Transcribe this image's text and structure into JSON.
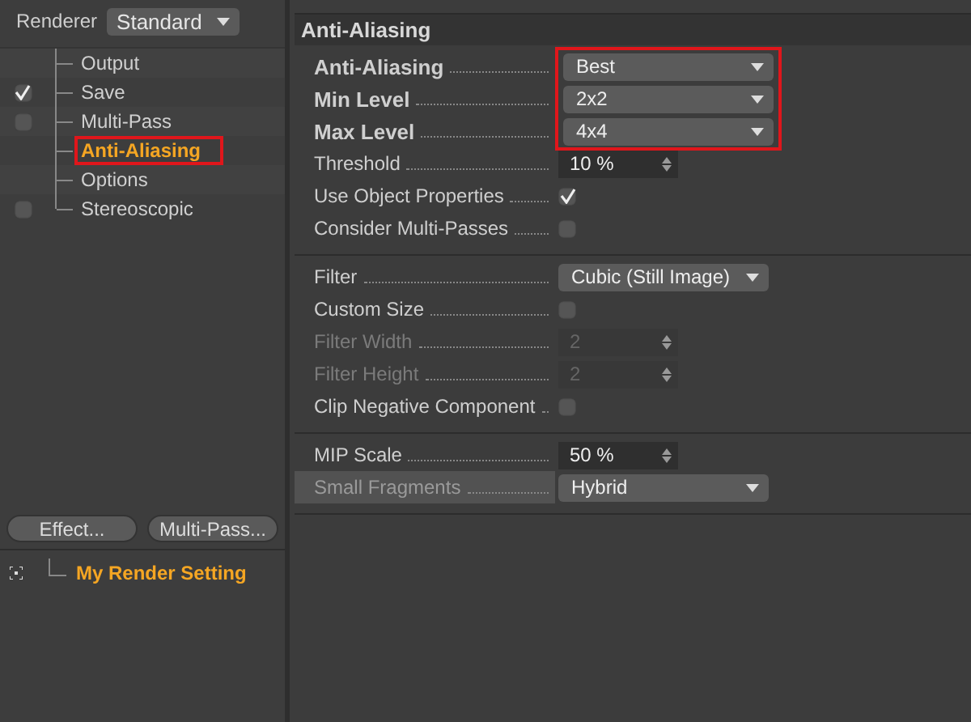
{
  "renderer": {
    "label": "Renderer",
    "value": "Standard"
  },
  "tree": [
    {
      "label": "Output",
      "has_checkbox": false,
      "selected": false,
      "marked": false
    },
    {
      "label": "Save",
      "has_checkbox": true,
      "checked": true,
      "selected": false,
      "marked": false
    },
    {
      "label": "Multi-Pass",
      "has_checkbox": true,
      "checked": false,
      "selected": false,
      "marked": false
    },
    {
      "label": "Anti-Aliasing",
      "has_checkbox": false,
      "selected": true,
      "marked": true
    },
    {
      "label": "Options",
      "has_checkbox": false,
      "selected": false,
      "marked": false
    },
    {
      "label": "Stereoscopic",
      "has_checkbox": true,
      "checked": false,
      "selected": false,
      "marked": false
    }
  ],
  "buttons": [
    "Effect...",
    "Multi-Pass..."
  ],
  "render_setting": {
    "label": "My Render Setting",
    "selected": true
  },
  "panel_title": "Anti-Aliasing",
  "sections": [
    {
      "groups": [
        {
          "marked": true,
          "rows": [
            {
              "kind": "dropdown",
              "label": "Anti-Aliasing",
              "value": "Best",
              "bold": true,
              "disabled": false,
              "highlighted": false
            },
            {
              "kind": "dropdown",
              "label": "Min Level",
              "value": "2x2",
              "bold": true,
              "disabled": false,
              "highlighted": false
            },
            {
              "kind": "dropdown",
              "label": "Max Level",
              "value": "4x4",
              "bold": true,
              "disabled": false,
              "highlighted": false
            }
          ]
        },
        {
          "marked": false,
          "rows": [
            {
              "kind": "spin",
              "label": "Threshold",
              "value": "10 %",
              "bold": false,
              "disabled": false,
              "highlighted": false
            },
            {
              "kind": "checkbox",
              "label": "Use Object Properties",
              "checked": true,
              "bold": false,
              "disabled": false,
              "highlighted": false
            },
            {
              "kind": "checkbox",
              "label": "Consider Multi-Passes",
              "checked": false,
              "bold": false,
              "disabled": false,
              "highlighted": false
            }
          ]
        }
      ]
    },
    {
      "groups": [
        {
          "marked": false,
          "rows": [
            {
              "kind": "dropdown",
              "label": "Filter",
              "value": "Cubic (Still Image)",
              "bold": false,
              "disabled": false,
              "highlighted": false
            },
            {
              "kind": "checkbox",
              "label": "Custom Size",
              "checked": false,
              "bold": false,
              "disabled": false,
              "highlighted": false
            },
            {
              "kind": "spin",
              "label": "Filter Width",
              "value": "2",
              "bold": false,
              "disabled": true,
              "highlighted": false
            },
            {
              "kind": "spin",
              "label": "Filter Height",
              "value": "2",
              "bold": false,
              "disabled": true,
              "highlighted": false
            },
            {
              "kind": "checkbox",
              "label": "Clip Negative Component",
              "checked": false,
              "bold": false,
              "disabled": false,
              "highlighted": false
            }
          ]
        }
      ]
    },
    {
      "groups": [
        {
          "marked": false,
          "rows": [
            {
              "kind": "spin",
              "label": "MIP Scale",
              "value": "50 %",
              "bold": false,
              "disabled": false,
              "highlighted": false
            },
            {
              "kind": "dropdown",
              "label": "Small Fragments",
              "value": "Hybrid",
              "bold": false,
              "disabled": false,
              "highlighted": true
            }
          ]
        }
      ]
    }
  ]
}
